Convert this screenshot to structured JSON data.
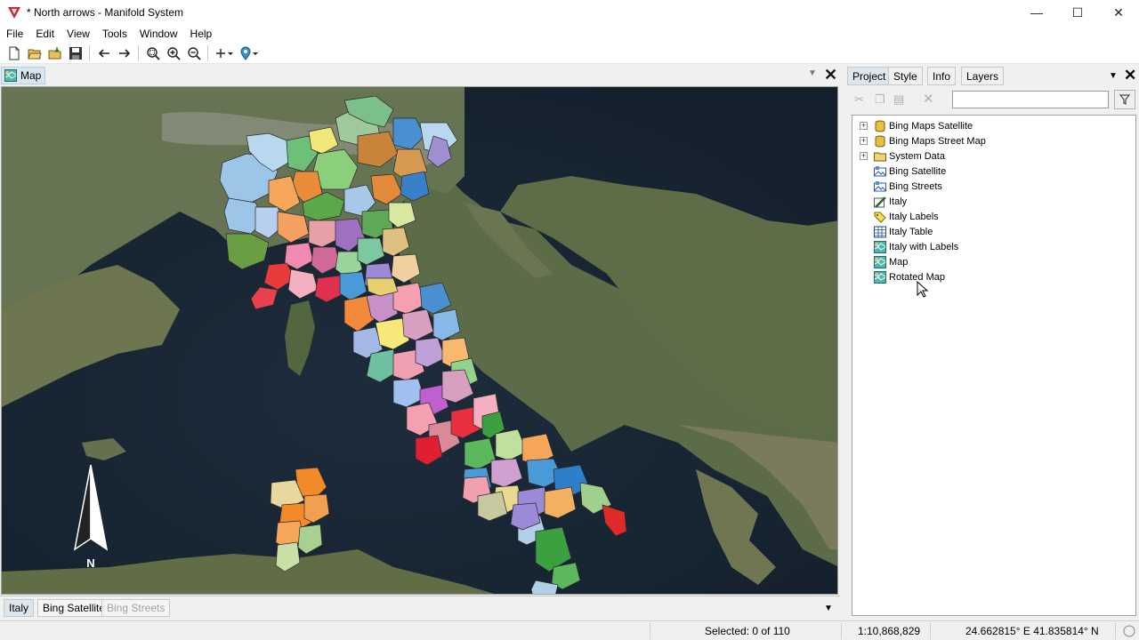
{
  "window": {
    "title": "* North arrows - Manifold System"
  },
  "menu": [
    "File",
    "Edit",
    "View",
    "Tools",
    "Window",
    "Help"
  ],
  "map_tab": {
    "label": "Map"
  },
  "north_arrow": {
    "label": "N"
  },
  "layer_tabs": [
    {
      "label": "Italy",
      "active": true
    },
    {
      "label": "Bing Satellite",
      "active": false
    },
    {
      "label": "Bing Streets",
      "active": false,
      "dimmed": true
    }
  ],
  "right_panel": {
    "tabs": [
      "Project",
      "Style",
      "Info",
      "Layers"
    ],
    "filter_value": "",
    "tree": [
      {
        "label": "Bing Maps Satellite",
        "icon": "database-icon",
        "expandable": true
      },
      {
        "label": "Bing Maps Street Map",
        "icon": "database-icon",
        "expandable": true
      },
      {
        "label": "System Data",
        "icon": "folder-icon",
        "expandable": true
      },
      {
        "label": "Bing Satellite",
        "icon": "image-icon",
        "expandable": false
      },
      {
        "label": "Bing Streets",
        "icon": "image-icon",
        "expandable": false
      },
      {
        "label": "Italy",
        "icon": "drawing-icon",
        "expandable": false
      },
      {
        "label": "Italy Labels",
        "icon": "labels-icon",
        "expandable": false
      },
      {
        "label": "Italy Table",
        "icon": "table-icon",
        "expandable": false
      },
      {
        "label": "Italy with Labels",
        "icon": "map-icon",
        "expandable": false
      },
      {
        "label": "Map",
        "icon": "map-icon",
        "expandable": false
      },
      {
        "label": "Rotated Map",
        "icon": "map-icon",
        "expandable": false
      }
    ]
  },
  "status": {
    "selected": "Selected: 0 of 110",
    "scale": "1:10,868,829",
    "coords": "24.662815° E 41.835814° N"
  }
}
